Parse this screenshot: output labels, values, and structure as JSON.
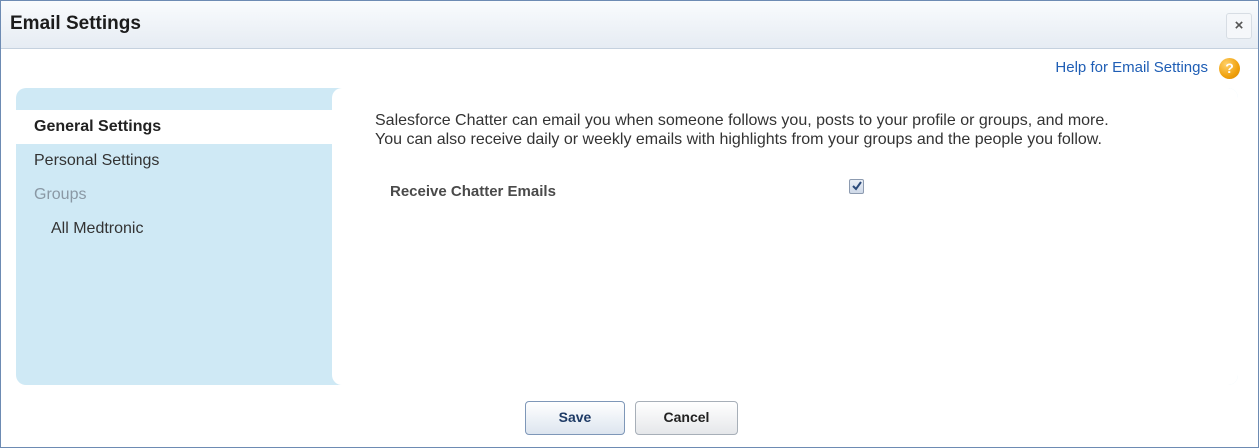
{
  "dialog": {
    "title": "Email Settings",
    "close_glyph": "×",
    "help_link": "Help for Email Settings",
    "help_icon_glyph": "?"
  },
  "nav": {
    "general": "General Settings",
    "personal": "Personal Settings",
    "groups_heading": "Groups",
    "groups": [
      "All Medtronic"
    ]
  },
  "content": {
    "description_line1": "Salesforce Chatter can email you when someone follows you, posts to your profile or groups, and more.",
    "description_line2": "You can also receive daily or weekly emails with highlights from your groups and the people you follow.",
    "receive_label": "Receive Chatter Emails",
    "receive_checked": true
  },
  "buttons": {
    "save": "Save",
    "cancel": "Cancel"
  },
  "colors": {
    "panel": "#cfe9f5",
    "link": "#1f5eb5",
    "help_icon": "#f0a10d"
  }
}
